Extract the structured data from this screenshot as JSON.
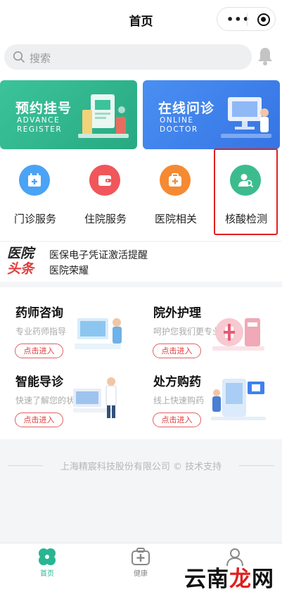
{
  "header": {
    "title": "首页"
  },
  "search": {
    "placeholder": "搜索"
  },
  "banners": [
    {
      "title": "预约挂号",
      "subtitle": "ADVANCE REGISTER",
      "color": "#2fb68d"
    },
    {
      "title": "在线问诊",
      "subtitle": "ONLINE DOCTOR",
      "color": "#3f82ec"
    }
  ],
  "services": [
    {
      "label": "门诊服务",
      "icon": "calendar-plus-icon",
      "color": "#4aa3f5"
    },
    {
      "label": "住院服务",
      "icon": "wallet-icon",
      "color": "#f0565a"
    },
    {
      "label": "医院相关",
      "icon": "medical-kit-icon",
      "color": "#f68a32"
    },
    {
      "label": "核酸检测",
      "icon": "doctor-search-icon",
      "color": "#3cbc8e"
    }
  ],
  "news": {
    "brand_line1": "医院",
    "brand_line2": "头条",
    "items": [
      "医保电子凭证激活提醒",
      "医院荣耀"
    ]
  },
  "cards": [
    {
      "title": "药师咨询",
      "subtitle": "专业药师指导",
      "button": "点击进入"
    },
    {
      "title": "院外护理",
      "subtitle": "呵护您我们更专业",
      "button": "点击进入"
    },
    {
      "title": "智能导诊",
      "subtitle": "快速了解您的状况",
      "button": "点击进入"
    },
    {
      "title": "处方购药",
      "subtitle": "线上快速购药",
      "button": "点击进入"
    }
  ],
  "footer": {
    "text": "上海精宸科技股份有限公司 © 技术支持"
  },
  "tabbar": {
    "items": [
      {
        "label": "首页",
        "icon": "clover-home-icon",
        "active": true
      },
      {
        "label": "健康",
        "icon": "medical-box-icon",
        "active": false
      },
      {
        "label": "",
        "icon": "profile-icon",
        "active": false
      }
    ],
    "accent": "#2ab592"
  },
  "watermark": {
    "part1": "云南",
    "part2": "龙",
    "part3": "网"
  }
}
